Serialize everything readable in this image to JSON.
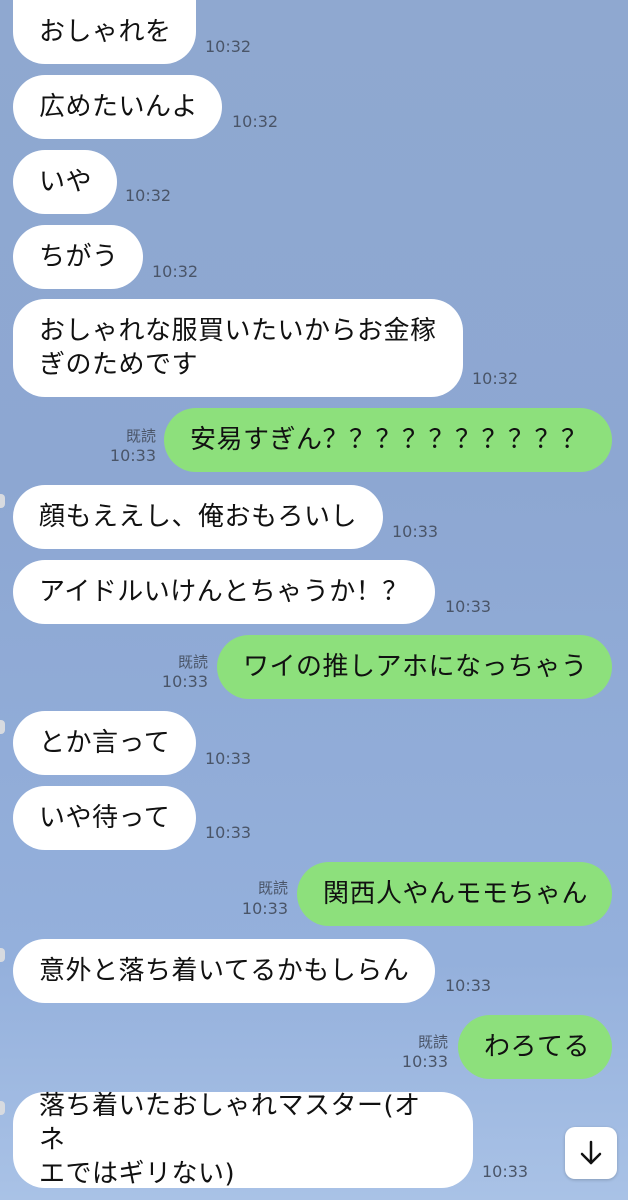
{
  "messages": [
    {
      "side": "in",
      "text": "おしゃれを",
      "time": "10:32"
    },
    {
      "side": "in",
      "text": "広めたいんよ",
      "time": "10:32"
    },
    {
      "side": "in",
      "text": "いや",
      "time": "10:32"
    },
    {
      "side": "in",
      "text": "ちがう",
      "time": "10:32"
    },
    {
      "side": "in",
      "lines": [
        "おしゃれな服買いたいからお金稼",
        "ぎのためです"
      ],
      "time": "10:32"
    },
    {
      "side": "out",
      "text": "安易すぎん？？？？？？？？？？",
      "read": "既読",
      "time": "10:33"
    },
    {
      "side": "in",
      "text": "顔もええし、俺おもろいし",
      "time": "10:33"
    },
    {
      "side": "in",
      "text": "アイドルいけんとちゃうか！？",
      "time": "10:33"
    },
    {
      "side": "out",
      "text": "ワイの推しアホになっちゃう",
      "read": "既読",
      "time": "10:33"
    },
    {
      "side": "in",
      "text": "とか言って",
      "time": "10:33"
    },
    {
      "side": "in",
      "text": "いや待って",
      "time": "10:33"
    },
    {
      "side": "out",
      "text": "関西人やんモモちゃん",
      "read": "既読",
      "time": "10:33"
    },
    {
      "side": "in",
      "text": "意外と落ち着いてるかもしらん",
      "time": "10:33"
    },
    {
      "side": "out",
      "text": "わろてる",
      "read": "既読",
      "time": "10:33"
    },
    {
      "side": "in",
      "lines": [
        "落ち着いたおしゃれマスター(オネ",
        "エではギリない)"
      ],
      "time": "10:33"
    }
  ],
  "scroll_button": {
    "icon": "arrow-down-icon"
  },
  "colors": {
    "background": "#8fa8d0",
    "incoming_bubble": "#ffffff",
    "outgoing_bubble": "#8de07c",
    "meta_text": "#4a5568"
  }
}
